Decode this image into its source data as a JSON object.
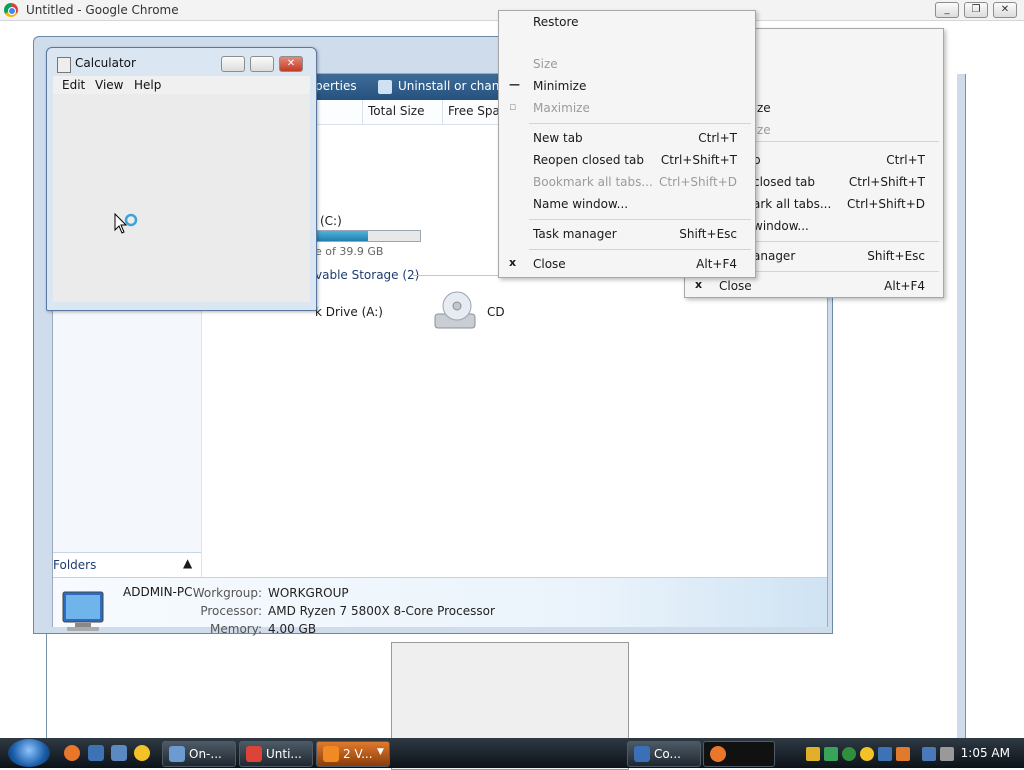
{
  "chrome": {
    "title": "Untitled - Google Chrome",
    "minimize": "_",
    "restore": "❐",
    "close": "✕"
  },
  "explorer": {
    "cmd_properties": "perties",
    "cmd_uninstall": "Uninstall or change a",
    "col_total_size": "Total Size",
    "col_free_space": "Free Spac",
    "drive_c_label": "(C:)",
    "drive_c_free": "e of 39.9 GB",
    "drive_c_fill_fraction": 0.55,
    "removable_header": "vable Storage (2)",
    "floppy_label": "k Drive (A:)",
    "cd_label": "CD",
    "folders_label": "Folders",
    "computer_name": "ADDMIN-PC",
    "workgroup_label": "Workgroup:",
    "workgroup_value": "WORKGROUP",
    "processor_label": "Processor:",
    "processor_value": "AMD Ryzen 7 5800X 8-Core Processor",
    "memory_label": "Memory:",
    "memory_value": "4.00 GB"
  },
  "calculator": {
    "title": "Calculator",
    "menus": [
      "Edit",
      "View",
      "Help"
    ]
  },
  "front_menu": {
    "items": [
      {
        "label": "Restore",
        "shortcut": "",
        "icon": "",
        "disabled": false
      },
      {
        "label": "Size",
        "shortcut": "",
        "icon": "",
        "disabled": true
      },
      {
        "label": "Minimize",
        "shortcut": "",
        "icon": "—",
        "disabled": false
      },
      {
        "label": "Maximize",
        "shortcut": "",
        "icon": "▫",
        "disabled": true
      },
      {
        "label": "New tab",
        "shortcut": "Ctrl+T",
        "disabled": false
      },
      {
        "label": "Reopen closed tab",
        "shortcut": "Ctrl+Shift+T",
        "disabled": false
      },
      {
        "label": "Bookmark all tabs...",
        "shortcut": "Ctrl+Shift+D",
        "disabled": true
      },
      {
        "label": "Name window...",
        "shortcut": "",
        "disabled": false
      },
      {
        "label": "Task manager",
        "shortcut": "Shift+Esc",
        "disabled": false
      },
      {
        "label": "Close",
        "shortcut": "Alt+F4",
        "icon": "x",
        "disabled": false
      }
    ]
  },
  "back_menu": {
    "items": [
      {
        "label": "ze",
        "shortcut": ""
      },
      {
        "label": "ze",
        "shortcut": ""
      },
      {
        "label": "b",
        "shortcut": "Ctrl+T"
      },
      {
        "label": "closed tab",
        "shortcut": "Ctrl+Shift+T"
      },
      {
        "label": "ark all tabs...",
        "shortcut": "Ctrl+Shift+D"
      },
      {
        "label": "window...",
        "shortcut": ""
      },
      {
        "label": "anager",
        "shortcut": "Shift+Esc"
      },
      {
        "label": "Close",
        "shortcut": "Alt+F4",
        "icon": "x"
      }
    ]
  },
  "taskbar": {
    "buttons": [
      {
        "label": "On-...",
        "icon_color": "#6b9bd1"
      },
      {
        "label": "Unti...",
        "icon_color": "#db4437"
      },
      {
        "label": "2 V...",
        "icon_color": "#f08a24"
      },
      {
        "label": "Co...",
        "icon_color": "#3b6fb6"
      }
    ],
    "clock": "1:05 AM"
  }
}
